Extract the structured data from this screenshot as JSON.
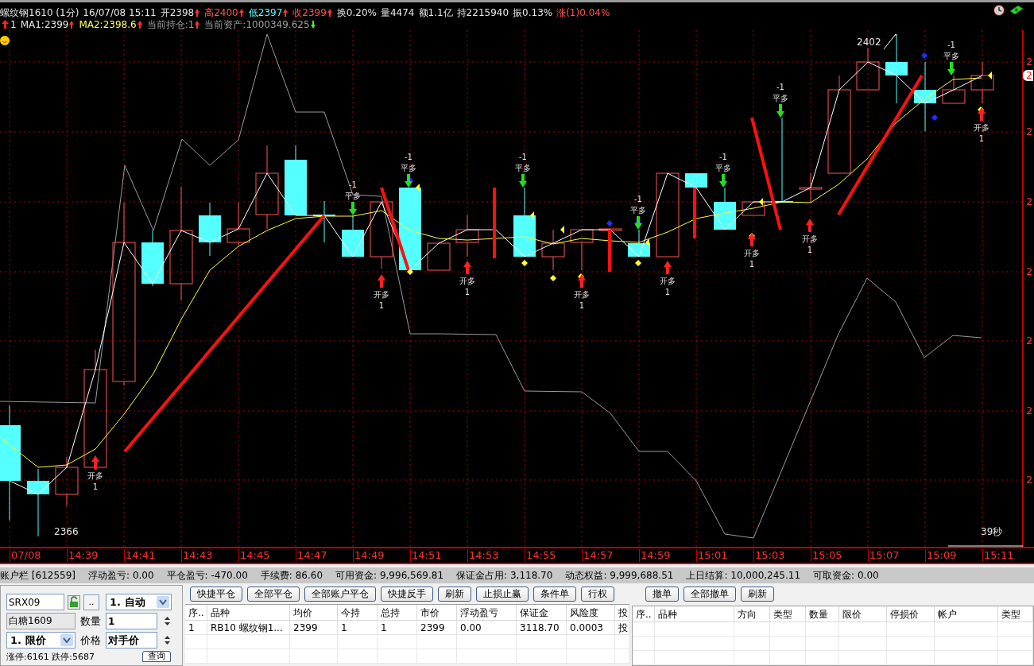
{
  "quote_bar": {
    "lines": [
      [
        {
          "text": "螺纹钢1610 (1分)",
          "color": "#e6e6e6"
        },
        {
          "text": "16/07/08 15:11",
          "color": "#e6e6e6"
        },
        {
          "text": "开2398",
          "color": "#e6e6e6",
          "up_tick": true
        },
        {
          "text": "高2400",
          "color": "#ff5454",
          "up_tick": true
        },
        {
          "text": "低2397",
          "color": "#54ffff",
          "up_tick": true
        },
        {
          "text": "收2399",
          "color": "#ff5454",
          "up_tick": true
        },
        {
          "text": "换0.20%",
          "color": "#e6e6e6"
        },
        {
          "text": "量4474",
          "color": "#e6e6e6"
        },
        {
          "text": "额1.1亿",
          "color": "#e6e6e6"
        },
        {
          "text": "持2215940",
          "color": "#e6e6e6"
        },
        {
          "text": "振0.13%",
          "color": "#e6e6e6"
        },
        {
          "text": "涨(1)0.04%",
          "color": "#ff5454"
        }
      ],
      [
        {
          "text": "1",
          "color": "#e6e6e6",
          "lead_arrow": true
        },
        {
          "text": "MA1:2399",
          "color": "#e6e6e6",
          "up_tick": true
        },
        {
          "text": "MA2:2398.6",
          "color": "#ffff54",
          "up_tick": true
        },
        {
          "text": "当前持仓:1",
          "color": "#a0a0a0",
          "up_tick": true
        },
        {
          "text": "当前资产:1000349.625",
          "color": "#a0a0a0",
          "down_tick": true
        }
      ]
    ]
  },
  "chart": {
    "high_label": "2402",
    "low_label": "2366",
    "countdown": "39秒",
    "price_flag": "2",
    "y_labels": [
      "2",
      "2",
      "2",
      "2",
      "2",
      "2",
      "2"
    ],
    "x_labels": [
      "07/08",
      "14:39",
      "14:41",
      "14:43",
      "14:45",
      "14:47",
      "14:49",
      "14:51",
      "14:53",
      "14:55",
      "14:57",
      "14:59",
      "15:01",
      "15:03",
      "15:05",
      "15:07",
      "15:09",
      "15:11"
    ],
    "signals": [
      {
        "kind": "open",
        "action": "开多",
        "qty": "1"
      },
      {
        "kind": "close",
        "action": "平多",
        "qty": "-1"
      },
      {
        "kind": "open",
        "action": "开多",
        "qty": "1"
      },
      {
        "kind": "close",
        "action": "平多",
        "qty": "-1"
      },
      {
        "kind": "open",
        "action": "开多",
        "qty": "1"
      },
      {
        "kind": "close",
        "action": "平多",
        "qty": "-1"
      },
      {
        "kind": "open",
        "action": "开多",
        "qty": "1"
      },
      {
        "kind": "close",
        "action": "平多",
        "qty": "-1"
      },
      {
        "kind": "open",
        "action": "开多",
        "qty": "1"
      },
      {
        "kind": "close",
        "action": "平多",
        "qty": "-1"
      },
      {
        "kind": "open",
        "action": "开多",
        "qty": "1"
      },
      {
        "kind": "close",
        "action": "平多",
        "qty": "-1"
      },
      {
        "kind": "open",
        "action": "开多",
        "qty": "1"
      },
      {
        "kind": "close",
        "action": "平多",
        "qty": "-1"
      },
      {
        "kind": "open",
        "action": "开多",
        "qty": "1"
      }
    ]
  },
  "account_bar": {
    "title": "账户栏",
    "account": "[612559]",
    "items": [
      {
        "label": "浮动盈亏:",
        "value": "0.00"
      },
      {
        "label": "平仓盈亏:",
        "value": "-470.00"
      },
      {
        "label": "手续费:",
        "value": "86.60"
      },
      {
        "label": "可用资金:",
        "value": "9,996,569.81"
      },
      {
        "label": "保证金占用:",
        "value": "3,118.70"
      },
      {
        "label": "动态权益:",
        "value": "9,999,688.51"
      },
      {
        "label": "上日结算:",
        "value": "10,000,245.11"
      },
      {
        "label": "可取资金:",
        "value": "0.00"
      }
    ]
  },
  "order_form": {
    "account": "SRX09",
    "more_button": "..",
    "mode": "1. 自动",
    "instrument": "白糖1609",
    "quantity_label": "数量",
    "quantity": "1",
    "order_type": "1. 限价",
    "price_label": "价格",
    "price": "对手价",
    "limits": "涨停:6161 跌停:5687",
    "query_button": "查询"
  },
  "positions": {
    "buttons": [
      "快捷平仓",
      "全部平仓",
      "全部账户平仓",
      "快捷反手",
      "刷新",
      "止损止赢",
      "条件单",
      "行权"
    ],
    "columns": [
      "序..",
      "品种",
      "均价",
      "今持",
      "总持",
      "市价",
      "浮动盈亏",
      "保证金",
      "风险度",
      "投"
    ],
    "rows": [
      [
        "1",
        "RB10 螺纹钢1...",
        "2399",
        "1",
        "1",
        "2399",
        "0.00",
        "3118.70",
        "0.0003",
        "投"
      ]
    ]
  },
  "orders": {
    "buttons": [
      "撤单",
      "全部撤单",
      "刷新"
    ],
    "columns": [
      "序..",
      "品种",
      "方向",
      "类型",
      "数量",
      "限价",
      "停损价",
      "帐户",
      "类型"
    ]
  }
}
